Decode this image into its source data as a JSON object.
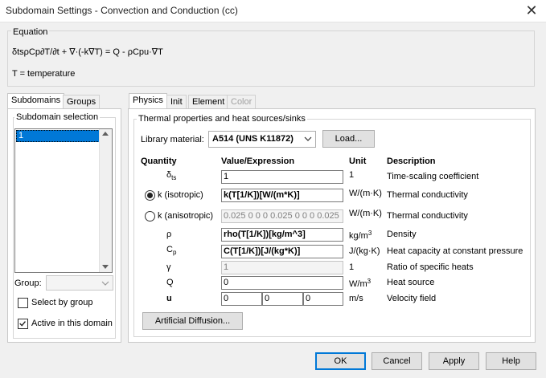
{
  "window": {
    "title": "Subdomain Settings - Convection and Conduction (cc)",
    "close_glyph": "✕"
  },
  "equation": {
    "group_label": "Equation",
    "text": "δtsρCp∂T/∂t + ∇·(-k∇T) = Q - ρCpu·∇T",
    "variable_note": "T = temperature"
  },
  "left_tabs": [
    {
      "label": "Subdomains",
      "active": true
    },
    {
      "label": "Groups",
      "active": false
    }
  ],
  "subdomain_selection": {
    "label": "Subdomain selection",
    "items": [
      "1"
    ],
    "group_label": "Group:",
    "group_value": "",
    "select_by_group": {
      "label": "Select by group",
      "checked": false
    },
    "active_in_domain": {
      "label": "Active in this domain",
      "checked": true
    }
  },
  "right_tabs": [
    {
      "label": "Physics",
      "state": "active"
    },
    {
      "label": "Init",
      "state": "normal"
    },
    {
      "label": "Element",
      "state": "normal"
    },
    {
      "label": "Color",
      "state": "disabled"
    }
  ],
  "thermal": {
    "group_label": "Thermal properties and heat sources/sinks",
    "library_label": "Library material:",
    "library_value": "A514 (UNS K11872)",
    "load_button": "Load...",
    "headers": {
      "quantity": "Quantity",
      "value": "Value/Expression",
      "unit": "Unit",
      "description": "Description"
    },
    "rows": {
      "dts": {
        "quantity": "δ",
        "quantity_sub": "ts",
        "value": "1",
        "unit": "1",
        "description": "Time-scaling coefficient"
      },
      "k_iso": {
        "quantity": "k (isotropic)",
        "value": "k(T[1/K])[W/(m*K)]",
        "unit": "W/(m·K)",
        "description": "Thermal conductivity",
        "selected": true
      },
      "k_aniso": {
        "quantity": "k (anisotropic)",
        "value": "0.025 0 0 0 0.025 0 0 0 0.025",
        "unit": "W/(m·K)",
        "description": "Thermal conductivity",
        "selected": false
      },
      "rho": {
        "quantity": "ρ",
        "value": "rho(T[1/K])[kg/m^3]",
        "unit": "kg/m",
        "unit_sup": "3",
        "description": "Density"
      },
      "cp": {
        "quantity": "C",
        "quantity_sub": "p",
        "value": "C(T[1/K])[J/(kg*K)]",
        "unit": "J/(kg·K)",
        "description": "Heat capacity at constant pressure"
      },
      "gamma": {
        "quantity": "γ",
        "value": "1",
        "unit": "1",
        "description": "Ratio of specific heats"
      },
      "q": {
        "quantity": "Q",
        "value": "0",
        "unit": "W/m",
        "unit_sup": "3",
        "description": "Heat source"
      },
      "u": {
        "quantity": "u",
        "values": [
          "0",
          "0",
          "0"
        ],
        "unit": "m/s",
        "description": "Velocity field"
      }
    },
    "artificial_diffusion_button": "Artificial Diffusion..."
  },
  "footer": {
    "ok": "OK",
    "cancel": "Cancel",
    "apply": "Apply",
    "help": "Help"
  },
  "colors": {
    "accent": "#0078d7",
    "selection": "#0078d7"
  }
}
